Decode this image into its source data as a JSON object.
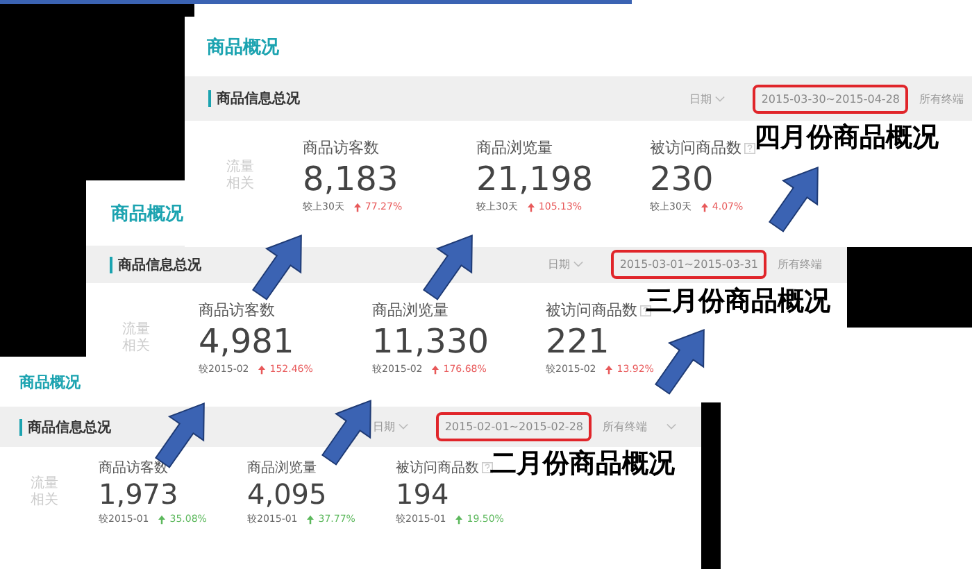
{
  "panels": [
    {
      "title": "商品概况",
      "section_title": "商品信息总况",
      "date_label": "日期",
      "date_range": "2015-03-30~2015-04-28",
      "highlighted": true,
      "terminal_label": "所有终端",
      "terminal_dropdown": false,
      "side_label": [
        "流量",
        "相关"
      ],
      "caption": "四月份商品概况",
      "metrics": [
        {
          "label": "商品访客数",
          "help": false,
          "value": "8,183",
          "compare_label": "较上30天",
          "rising": true,
          "change": "77.27%",
          "color": "#e8595a"
        },
        {
          "label": "商品浏览量",
          "help": false,
          "value": "21,198",
          "compare_label": "较上30天",
          "rising": true,
          "change": "105.13%",
          "color": "#e8595a"
        },
        {
          "label": "被访问商品数",
          "help": true,
          "value": "230",
          "compare_label": "较上30天",
          "rising": true,
          "change": "4.07%",
          "color": "#e8595a"
        }
      ]
    },
    {
      "title": "商品概况",
      "section_title": "商品信息总况",
      "date_label": "日期",
      "date_range": "2015-03-01~2015-03-31",
      "highlighted": true,
      "terminal_label": "所有终端",
      "terminal_dropdown": false,
      "side_label": [
        "流量",
        "相关"
      ],
      "caption": "三月份商品概况",
      "metrics": [
        {
          "label": "商品访客数",
          "help": false,
          "value": "4,981",
          "compare_label": "较2015-02",
          "rising": true,
          "change": "152.46%",
          "color": "#e8595a"
        },
        {
          "label": "商品浏览量",
          "help": false,
          "value": "11,330",
          "compare_label": "较2015-02",
          "rising": true,
          "change": "176.68%",
          "color": "#e8595a"
        },
        {
          "label": "被访问商品数",
          "help": true,
          "value": "221",
          "compare_label": "较2015-02",
          "rising": true,
          "change": "13.92%",
          "color": "#e8595a"
        }
      ]
    },
    {
      "title": "商品概况",
      "section_title": "商品信息总况",
      "date_label": "日期",
      "date_range": "2015-02-01~2015-02-28",
      "highlighted": true,
      "terminal_label": "所有终端",
      "terminal_dropdown": true,
      "side_label": [
        "流量",
        "相关"
      ],
      "caption": "二月份商品概况",
      "metrics": [
        {
          "label": "商品访客数",
          "help": false,
          "value": "1,973",
          "compare_label": "较2015-01",
          "rising": true,
          "change": "35.08%",
          "color": "#5cb85c"
        },
        {
          "label": "商品浏览量",
          "help": false,
          "value": "4,095",
          "compare_label": "较2015-01",
          "rising": true,
          "change": "37.77%",
          "color": "#5cb85c"
        },
        {
          "label": "被访问商品数",
          "help": true,
          "value": "194",
          "compare_label": "较2015-01",
          "rising": true,
          "change": "19.50%",
          "color": "#5cb85c"
        }
      ]
    }
  ]
}
